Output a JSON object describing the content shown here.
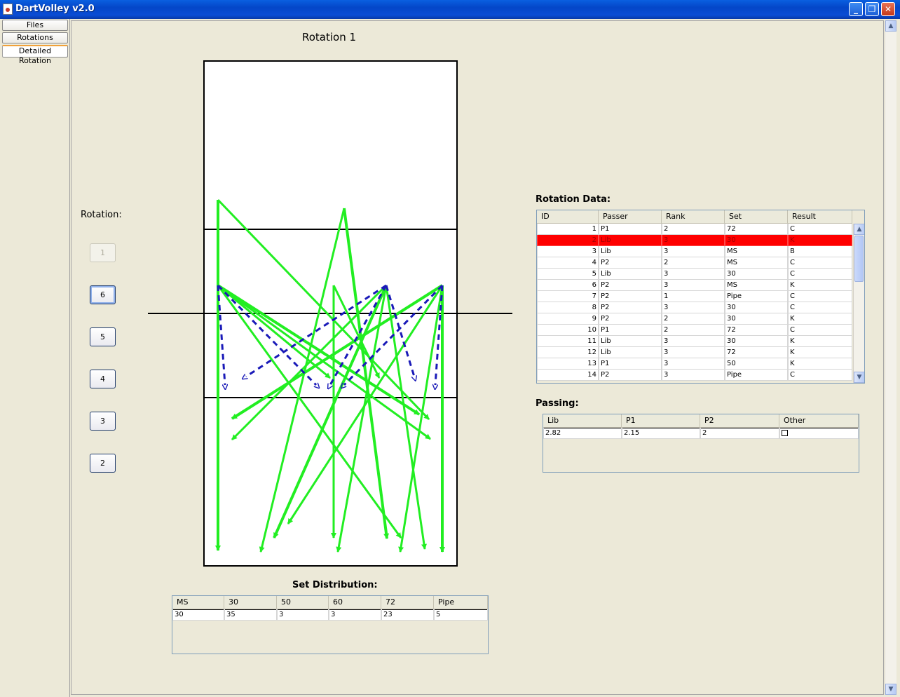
{
  "window": {
    "title": "DartVolley v2.0",
    "minimize_glyph": "_",
    "maximize_glyph": "❐",
    "close_glyph": "✕",
    "icon": "java-cup-icon"
  },
  "tabs": [
    "Files",
    "Rotations",
    "Detailed Rotation"
  ],
  "active_tab": "Detailed Rotation",
  "court": {
    "title": "Rotation 1",
    "solid_color": "#22ee22",
    "dashed_color": "#1a1ab8"
  },
  "rotation_panel": {
    "label": "Rotation:",
    "buttons": [
      "1",
      "6",
      "5",
      "4",
      "3",
      "2"
    ],
    "disabled": "1",
    "focused": "6"
  },
  "rotation_data": {
    "label": "Rotation Data:",
    "columns": [
      "ID",
      "Passer",
      "Rank",
      "Set",
      "Result"
    ],
    "selected_id": "2",
    "highlight_color": "#ff0000",
    "rows": [
      [
        "1",
        "P1",
        "2",
        "72",
        "C"
      ],
      [
        "2",
        "Lib",
        "3",
        "30",
        "K"
      ],
      [
        "3",
        "Lib",
        "3",
        "MS",
        "B"
      ],
      [
        "4",
        "P2",
        "2",
        "MS",
        "C"
      ],
      [
        "5",
        "Lib",
        "3",
        "30",
        "C"
      ],
      [
        "6",
        "P2",
        "3",
        "MS",
        "K"
      ],
      [
        "7",
        "P2",
        "1",
        "Pipe",
        "C"
      ],
      [
        "8",
        "P2",
        "3",
        "30",
        "C"
      ],
      [
        "9",
        "P2",
        "2",
        "30",
        "K"
      ],
      [
        "10",
        "P1",
        "2",
        "72",
        "C"
      ],
      [
        "11",
        "Lib",
        "3",
        "30",
        "K"
      ],
      [
        "12",
        "Lib",
        "3",
        "72",
        "K"
      ],
      [
        "13",
        "P1",
        "3",
        "50",
        "K"
      ],
      [
        "14",
        "P2",
        "3",
        "Pipe",
        "C"
      ]
    ]
  },
  "passing": {
    "label": "Passing:",
    "columns": [
      "Lib",
      "P1",
      "P2",
      "Other"
    ],
    "values": [
      "2.82",
      "2.15",
      "2"
    ]
  },
  "set_distribution": {
    "label": "Set Distribution:",
    "columns": [
      "MS",
      "30",
      "50",
      "60",
      "72",
      "Pipe"
    ],
    "values": [
      "30",
      "35",
      "3",
      "3",
      "23",
      "5"
    ]
  }
}
